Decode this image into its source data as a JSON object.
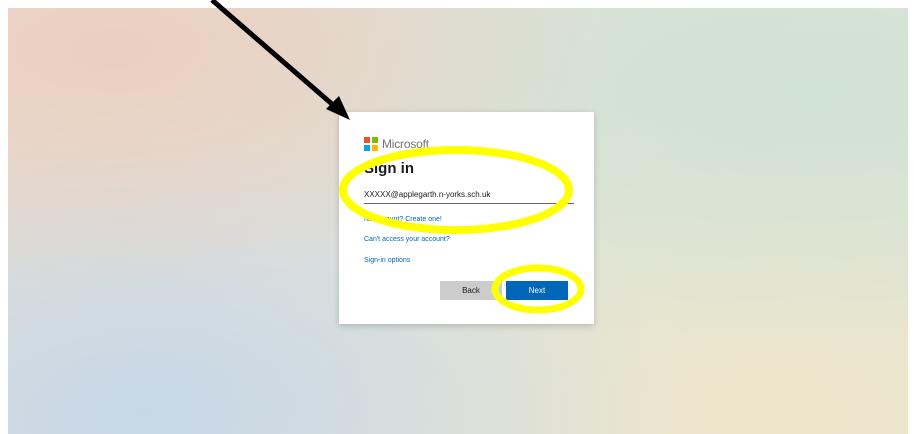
{
  "logo": {
    "text": "Microsoft",
    "colors": [
      "#f25022",
      "#7fba00",
      "#00a4ef",
      "#ffb900"
    ]
  },
  "signin": {
    "title": "Sign in",
    "email_value": "XXXXX@applegarth.n-yorks.sch.uk",
    "no_account_link": "No account? Create one!",
    "cant_access_link": "Can't access your account?",
    "options_link": "Sign-in options",
    "back_label": "Back",
    "next_label": "Next"
  },
  "colors": {
    "accent": "#0067b8",
    "highlight": "#ffff00"
  }
}
